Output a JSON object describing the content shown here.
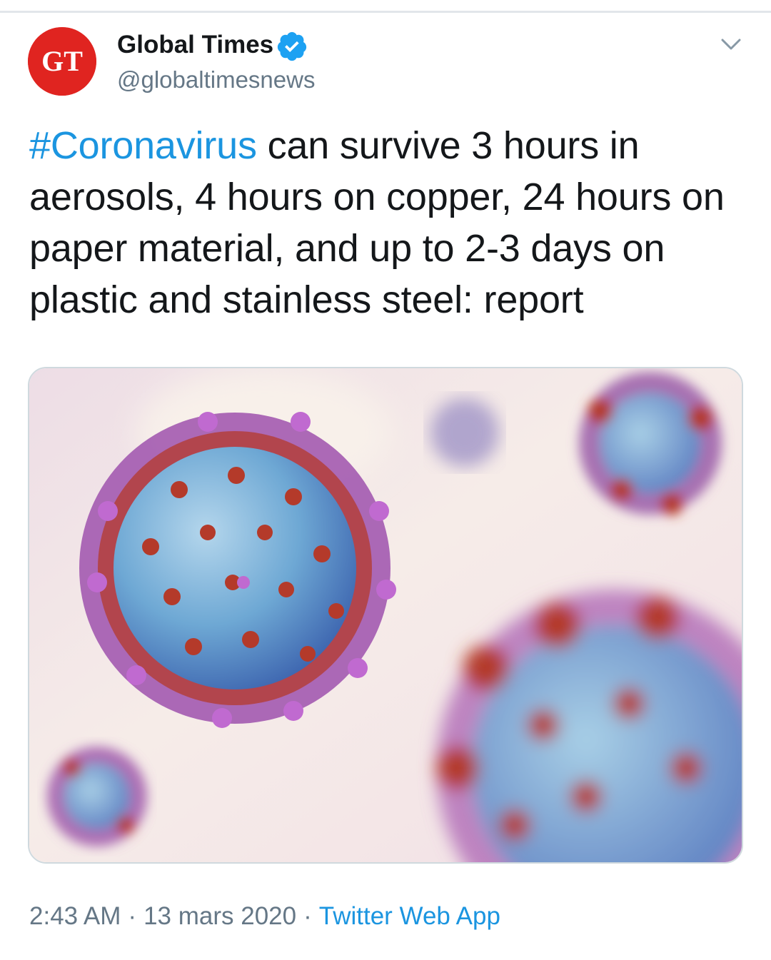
{
  "account": {
    "display_name": "Global Times",
    "handle": "@globaltimesnews",
    "avatar_text": "GT",
    "verified": true,
    "brand_color": "#e02420",
    "verified_color": "#1da1f2"
  },
  "tweet": {
    "hashtag": "#Coronavirus",
    "text": " can survive 3 hours in aerosols, 4 hours on copper, 24 hours on paper material, and up to 2-3 days on plastic and stainless steel: report"
  },
  "meta": {
    "time": "2:43 AM",
    "separator": "·",
    "date": "13 mars 2020",
    "source": "Twitter Web App"
  },
  "icons": {
    "verified": "verified-badge-icon",
    "menu": "chevron-down-icon"
  },
  "colors": {
    "link": "#1b95e0",
    "text": "#14171a",
    "secondary": "#657786"
  }
}
